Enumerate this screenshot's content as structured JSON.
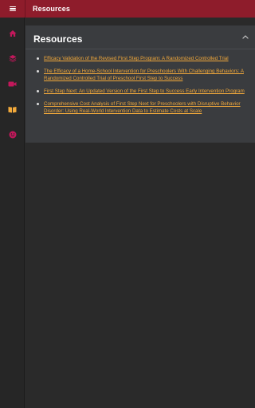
{
  "header": {
    "title": "Resources",
    "accent": "#8e1c2b"
  },
  "sidebar": {
    "items": [
      {
        "icon": "home-icon",
        "color": "#c2185b"
      },
      {
        "icon": "layers-icon",
        "color": "#c2185b"
      },
      {
        "icon": "video-icon",
        "color": "#c2185b"
      },
      {
        "icon": "book-icon",
        "color": "#f2a93b",
        "active": true
      },
      {
        "icon": "smiley-icon",
        "color": "#c2185b"
      }
    ]
  },
  "panel": {
    "title": "Resources",
    "link_color": "#f2a93b",
    "links": [
      "Efficacy Validation of the Revised First Step Program: A Randomized Controlled Trial",
      "The Efficacy of a Home-School Intervention for Preschoolers With Challenging Behaviors: A Randomized Controlled Trial of Preschool First Step to Success",
      "First Step Next: An Updated Version of the First Step to Success Early Intervention Program",
      "Comprehensive Cost Analysis of First Step Next for Preschoolers with Disruptive Behavior Disorder: Using Real-World Intervention Data to Estimate Costs at Scale"
    ]
  }
}
